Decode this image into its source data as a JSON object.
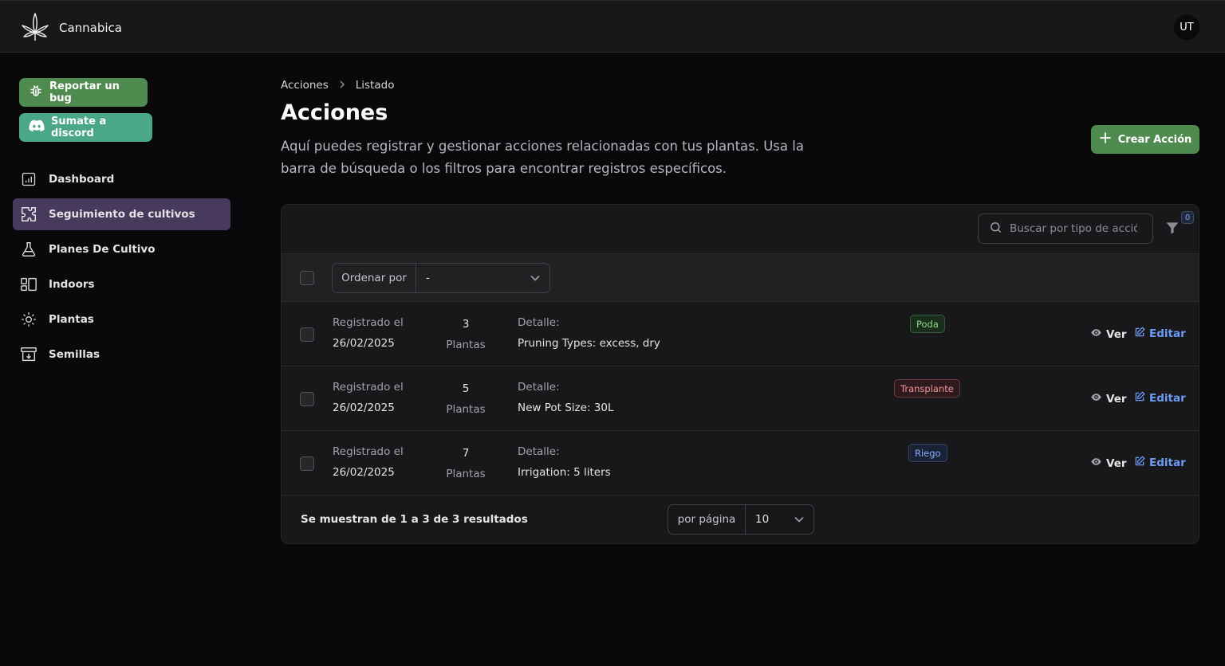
{
  "header": {
    "app_name": "Cannabica",
    "avatar_initials": "UT"
  },
  "sidebar": {
    "bug_button": "Reportar un bug",
    "discord_button": "Sumate a discord",
    "items": [
      {
        "label": "Dashboard",
        "icon": "chart-icon"
      },
      {
        "label": "Seguimiento de cultivos",
        "icon": "puzzle-icon",
        "active": true
      },
      {
        "label": "Planes De Cultivo",
        "icon": "flask-icon"
      },
      {
        "label": "Indoors",
        "icon": "layout-icon"
      },
      {
        "label": "Plantas",
        "icon": "sun-icon"
      },
      {
        "label": "Semillas",
        "icon": "archive-icon"
      }
    ]
  },
  "main": {
    "breadcrumb": [
      "Acciones",
      "Listado"
    ],
    "title": "Acciones",
    "description": "Aquí puedes registrar y gestionar acciones relacionadas con tus plantas. Usa la barra de búsqueda o los filtros para encontrar registros específicos.",
    "create_button": "Crear Acción",
    "search_placeholder": "Buscar por tipo de acción",
    "filter_count": "0",
    "sort_label": "Ordenar por",
    "sort_value": "-",
    "rows": [
      {
        "registered_label": "Registrado el",
        "date": "26/02/2025",
        "count": "3",
        "count_label": "Plantas",
        "detail_label": "Detalle:",
        "detail": "Pruning Types: excess, dry",
        "badge": "Poda",
        "badge_color": "#8fd68b",
        "view": "Ver",
        "edit": "Editar"
      },
      {
        "registered_label": "Registrado el",
        "date": "26/02/2025",
        "count": "5",
        "count_label": "Plantas",
        "detail_label": "Detalle:",
        "detail": "New Pot Size: 30L",
        "badge": "Transplante",
        "badge_color": "#f0959c",
        "view": "Ver",
        "edit": "Editar"
      },
      {
        "registered_label": "Registrado el",
        "date": "26/02/2025",
        "count": "7",
        "count_label": "Plantas",
        "detail_label": "Detalle:",
        "detail": "Irrigation: 5 liters",
        "badge": "Riego",
        "badge_color": "#8ab0ff",
        "view": "Ver",
        "edit": "Editar"
      }
    ],
    "results_text": "Se muestran de 1 a 3 de 3 resultados",
    "per_page_label": "por página",
    "per_page_value": "10"
  }
}
